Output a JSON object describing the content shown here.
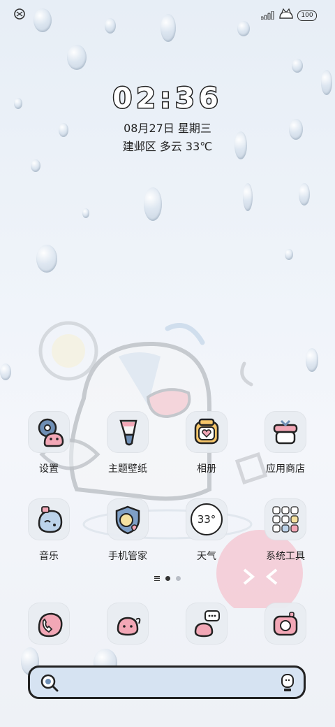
{
  "status": {
    "left_icon": "sync-icon",
    "signal_icon": "signal-bars-icon",
    "notch_icon": "cartoon-cat-icon",
    "battery": "100"
  },
  "clock": {
    "time": "02:36",
    "date": "08月27日 星期三",
    "weather": "建邺区 多云 33℃"
  },
  "apps_row1": [
    {
      "label": "设置",
      "icon": "settings-icon"
    },
    {
      "label": "主题壁纸",
      "icon": "theme-brush-icon"
    },
    {
      "label": "相册",
      "icon": "gallery-icon"
    },
    {
      "label": "应用商店",
      "icon": "app-store-icon"
    }
  ],
  "apps_row2": [
    {
      "label": "音乐",
      "icon": "music-icon"
    },
    {
      "label": "手机管家",
      "icon": "phone-manager-icon"
    },
    {
      "label": "天气",
      "icon": "weather-icon",
      "badge": "33°"
    },
    {
      "label": "系统工具",
      "icon": "system-tools-folder-icon"
    }
  ],
  "dock": [
    {
      "icon": "phone-icon"
    },
    {
      "icon": "contacts-icon"
    },
    {
      "icon": "messages-icon"
    },
    {
      "icon": "camera-icon"
    }
  ],
  "page_indicator": {
    "pages": 2,
    "active": 0
  },
  "search": {
    "left_icon": "search-icon",
    "right_icon": "voice-assistant-icon"
  },
  "colors": {
    "pink": "#f2a7b6",
    "outline": "#222222",
    "tile": "#e8ecf1",
    "search_bg": "#d6e3f2"
  }
}
